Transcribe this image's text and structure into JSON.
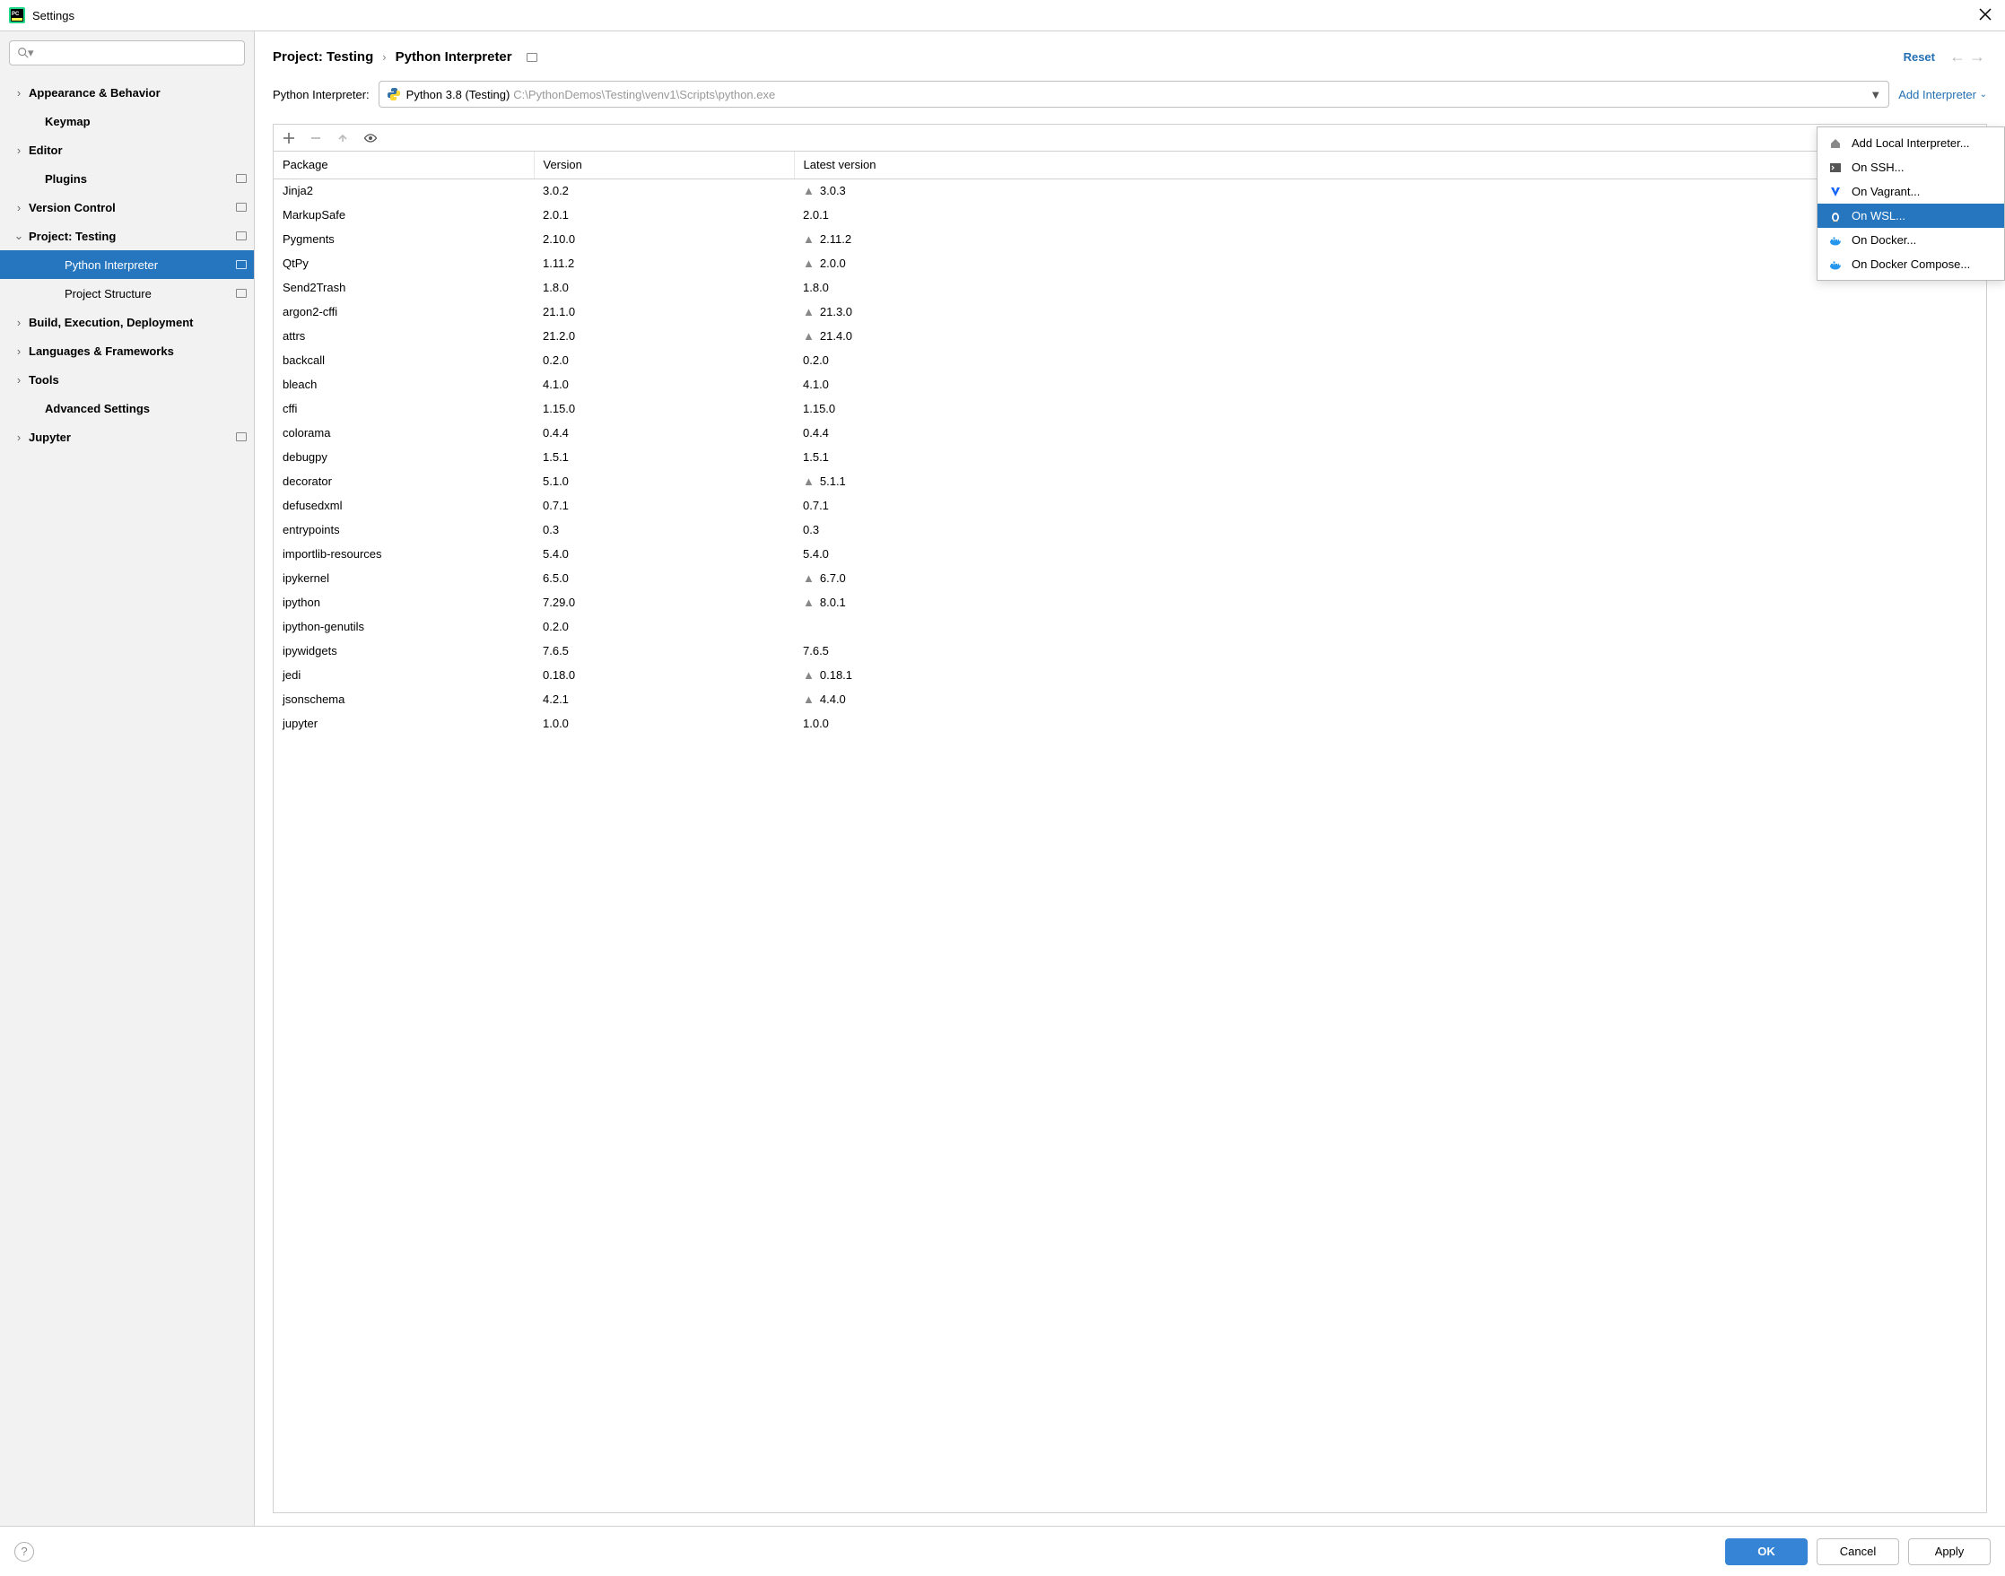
{
  "window": {
    "title": "Settings"
  },
  "sidebar": {
    "search_placeholder": "",
    "items": [
      {
        "label": "Appearance & Behavior",
        "chevron": "right",
        "bold": true,
        "indent": 0,
        "badge": false
      },
      {
        "label": "Keymap",
        "chevron": "",
        "bold": true,
        "indent": 1,
        "badge": false
      },
      {
        "label": "Editor",
        "chevron": "right",
        "bold": true,
        "indent": 0,
        "badge": false
      },
      {
        "label": "Plugins",
        "chevron": "",
        "bold": true,
        "indent": 1,
        "badge": true
      },
      {
        "label": "Version Control",
        "chevron": "right",
        "bold": true,
        "indent": 0,
        "badge": true
      },
      {
        "label": "Project: Testing",
        "chevron": "down",
        "bold": true,
        "indent": 0,
        "badge": true
      },
      {
        "label": "Python Interpreter",
        "chevron": "",
        "bold": false,
        "indent": 2,
        "badge": true,
        "selected": true
      },
      {
        "label": "Project Structure",
        "chevron": "",
        "bold": false,
        "indent": 2,
        "badge": true
      },
      {
        "label": "Build, Execution, Deployment",
        "chevron": "right",
        "bold": true,
        "indent": 0,
        "badge": false
      },
      {
        "label": "Languages & Frameworks",
        "chevron": "right",
        "bold": true,
        "indent": 0,
        "badge": false
      },
      {
        "label": "Tools",
        "chevron": "right",
        "bold": true,
        "indent": 0,
        "badge": false
      },
      {
        "label": "Advanced Settings",
        "chevron": "",
        "bold": true,
        "indent": 1,
        "badge": false
      },
      {
        "label": "Jupyter",
        "chevron": "right",
        "bold": true,
        "indent": 0,
        "badge": true
      }
    ]
  },
  "header": {
    "breadcrumb1": "Project: Testing",
    "breadcrumb2": "Python Interpreter",
    "reset": "Reset"
  },
  "interpreter": {
    "label": "Python Interpreter:",
    "selected_name": "Python 3.8 (Testing)",
    "selected_path": "C:\\PythonDemos\\Testing\\venv1\\Scripts\\python.exe",
    "add_label": "Add Interpreter"
  },
  "dropdown": {
    "items": [
      {
        "label": "Add Local Interpreter...",
        "icon": "home"
      },
      {
        "label": "On SSH...",
        "icon": "ssh"
      },
      {
        "label": "On Vagrant...",
        "icon": "vagrant"
      },
      {
        "label": "On WSL...",
        "icon": "linux",
        "selected": true
      },
      {
        "label": "On Docker...",
        "icon": "docker"
      },
      {
        "label": "On Docker Compose...",
        "icon": "docker"
      }
    ]
  },
  "table": {
    "headers": {
      "package": "Package",
      "version": "Version",
      "latest": "Latest version"
    },
    "rows": [
      {
        "pkg": "Jinja2",
        "ver": "3.0.2",
        "latest": "3.0.3",
        "up": true
      },
      {
        "pkg": "MarkupSafe",
        "ver": "2.0.1",
        "latest": "2.0.1",
        "up": false
      },
      {
        "pkg": "Pygments",
        "ver": "2.10.0",
        "latest": "2.11.2",
        "up": true
      },
      {
        "pkg": "QtPy",
        "ver": "1.11.2",
        "latest": "2.0.0",
        "up": true
      },
      {
        "pkg": "Send2Trash",
        "ver": "1.8.0",
        "latest": "1.8.0",
        "up": false
      },
      {
        "pkg": "argon2-cffi",
        "ver": "21.1.0",
        "latest": "21.3.0",
        "up": true
      },
      {
        "pkg": "attrs",
        "ver": "21.2.0",
        "latest": "21.4.0",
        "up": true
      },
      {
        "pkg": "backcall",
        "ver": "0.2.0",
        "latest": "0.2.0",
        "up": false
      },
      {
        "pkg": "bleach",
        "ver": "4.1.0",
        "latest": "4.1.0",
        "up": false
      },
      {
        "pkg": "cffi",
        "ver": "1.15.0",
        "latest": "1.15.0",
        "up": false
      },
      {
        "pkg": "colorama",
        "ver": "0.4.4",
        "latest": "0.4.4",
        "up": false
      },
      {
        "pkg": "debugpy",
        "ver": "1.5.1",
        "latest": "1.5.1",
        "up": false
      },
      {
        "pkg": "decorator",
        "ver": "5.1.0",
        "latest": "5.1.1",
        "up": true
      },
      {
        "pkg": "defusedxml",
        "ver": "0.7.1",
        "latest": "0.7.1",
        "up": false
      },
      {
        "pkg": "entrypoints",
        "ver": "0.3",
        "latest": "0.3",
        "up": false
      },
      {
        "pkg": "importlib-resources",
        "ver": "5.4.0",
        "latest": "5.4.0",
        "up": false
      },
      {
        "pkg": "ipykernel",
        "ver": "6.5.0",
        "latest": "6.7.0",
        "up": true
      },
      {
        "pkg": "ipython",
        "ver": "7.29.0",
        "latest": "8.0.1",
        "up": true
      },
      {
        "pkg": "ipython-genutils",
        "ver": "0.2.0",
        "latest": "",
        "up": false
      },
      {
        "pkg": "ipywidgets",
        "ver": "7.6.5",
        "latest": "7.6.5",
        "up": false
      },
      {
        "pkg": "jedi",
        "ver": "0.18.0",
        "latest": "0.18.1",
        "up": true
      },
      {
        "pkg": "jsonschema",
        "ver": "4.2.1",
        "latest": "4.4.0",
        "up": true
      },
      {
        "pkg": "jupyter",
        "ver": "1.0.0",
        "latest": "1.0.0",
        "up": false
      }
    ]
  },
  "footer": {
    "ok": "OK",
    "cancel": "Cancel",
    "apply": "Apply"
  }
}
